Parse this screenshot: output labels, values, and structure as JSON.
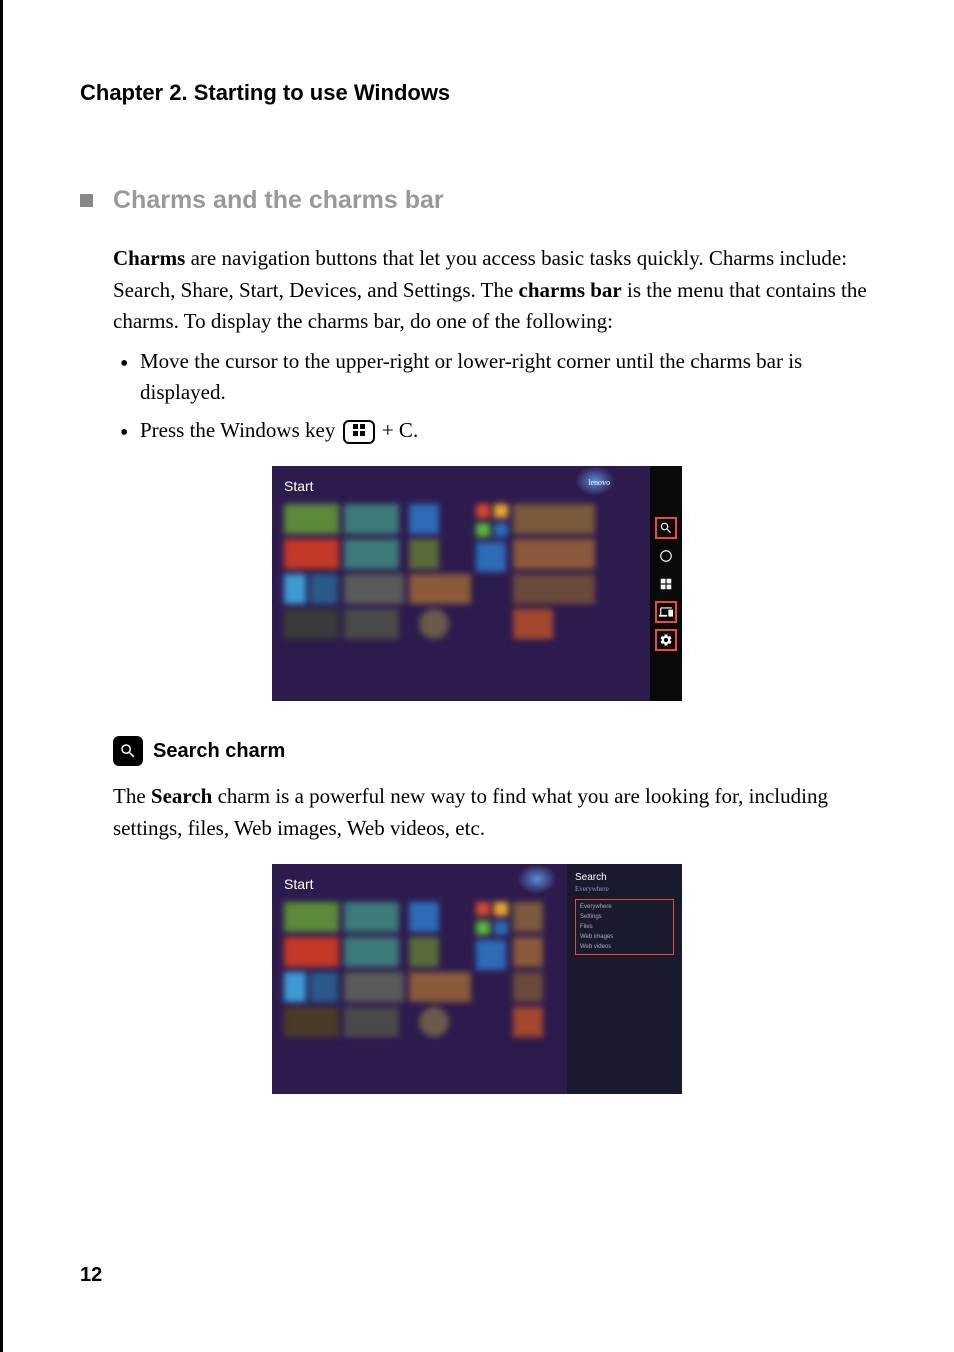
{
  "chapter": {
    "title": "Chapter 2. Starting to use Windows"
  },
  "section": {
    "title": "Charms and the charms bar",
    "intro_bold_1": "Charms",
    "intro_text_1": " are navigation buttons that let you access basic tasks quickly. Charms include: Search, Share, Start, Devices, and Settings. The ",
    "intro_bold_2": "charms bar",
    "intro_text_2": " is the menu that contains the charms. To display the charms bar, do one of the following:",
    "bullet_1": "Move the cursor to the upper-right or lower-right corner until the charms bar is displayed.",
    "bullet_2_pre": "Press the Windows key ",
    "bullet_2_post": " + C."
  },
  "screenshot1": {
    "start_label": "Start",
    "user_label": "lenovo",
    "charms": {
      "search": "Search",
      "share": "Share",
      "start": "Start",
      "devices": "Devices",
      "settings": "Settings"
    }
  },
  "subsection": {
    "title": "Search charm",
    "body_pre": "The ",
    "body_bold": "Search",
    "body_post": " charm is a powerful new way to find what you are looking for, including settings, files, Web images, Web videos, etc."
  },
  "screenshot2": {
    "start_label": "Start",
    "search_title": "Search",
    "search_sub": "Everywhere",
    "options": [
      "Everywhere",
      "Settings",
      "Files",
      "Web images",
      "Web videos"
    ]
  },
  "page_number": "12"
}
